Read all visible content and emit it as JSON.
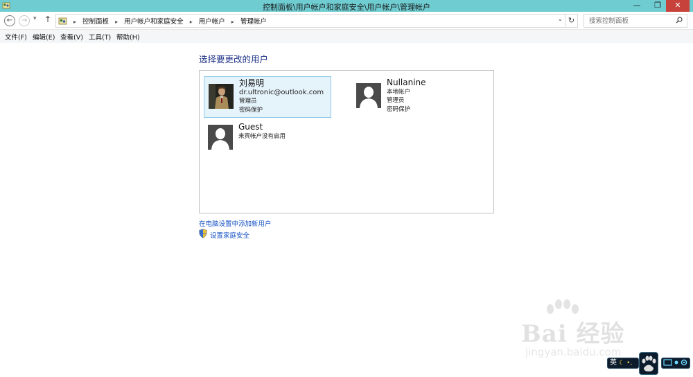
{
  "window": {
    "title": "控制面板\\用户帐户和家庭安全\\用户帐户\\管理帐户",
    "minimize_glyph": "—",
    "restore_glyph": "❐",
    "close_glyph": "✕"
  },
  "address_bar": {
    "back_glyph": "←",
    "forward_glyph": "→",
    "dropdown_glyph": "▾",
    "up_glyph": "↑",
    "crumbs": [
      "控制面板",
      "用户帐户和家庭安全",
      "用户帐户",
      "管理帐户"
    ],
    "crumb_separator": "▸",
    "address_dropdown_glyph": "⌄",
    "refresh_glyph": "↻",
    "search_placeholder": "搜索控制面板"
  },
  "menu": {
    "items": [
      "文件(F)",
      "编辑(E)",
      "查看(V)",
      "工具(T)",
      "帮助(H)"
    ]
  },
  "main": {
    "heading": "选择要更改的用户",
    "accounts": [
      {
        "name": "刘易明",
        "lines": [
          "dr.ultronic@outlook.com",
          "管理员",
          "密码保护"
        ],
        "selected": true
      },
      {
        "name": "Nullanine",
        "lines": [
          "本地帐户",
          "管理员",
          "密码保护"
        ],
        "selected": false
      },
      {
        "name": "Guest",
        "lines": [
          "来宾帐户没有启用"
        ],
        "selected": false
      }
    ],
    "add_user_link": "在电脑设置中添加新用户",
    "family_safety_link": "设置家庭安全"
  },
  "watermark": {
    "main": "Bai 经验",
    "sub": "jingyan.baidu.com"
  },
  "tray": {
    "lang": "英",
    "symbols": "☾ •,"
  },
  "colors": {
    "titlebar": "#6fcdd2",
    "close": "#c7423b",
    "link": "#1a56c7",
    "heading": "#1e3287",
    "selection": "#e5f3fb"
  }
}
